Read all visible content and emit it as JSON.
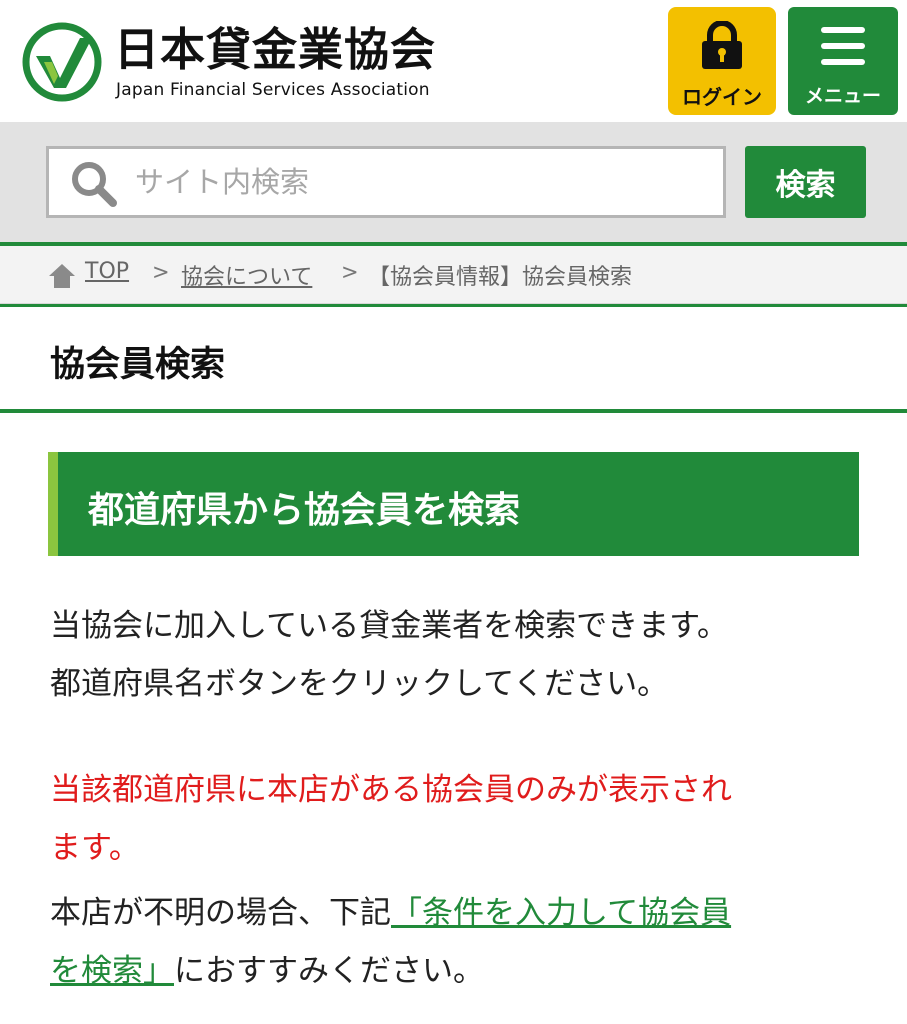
{
  "header": {
    "logo_jp": "日本貸金業協会",
    "logo_en": "Japan Financial Services Association",
    "login_label": "ログイン",
    "menu_label": "メニュー",
    "brand_green": "#218a3a",
    "login_yellow": "#f3c000"
  },
  "search": {
    "placeholder": "サイト内検索",
    "button_label": "検索"
  },
  "breadcrumb": {
    "items": [
      "TOP",
      "協会について",
      "【協会員情報】協会員検索"
    ],
    "separator": ">"
  },
  "page": {
    "title": "協会員検索"
  },
  "section": {
    "heading": "都道府県から協会員を検索"
  },
  "body": {
    "intro_line1": "当協会に加入している貸金業者を検索できます。",
    "intro_line2": "都道府県名ボタンをクリックしてください。",
    "notice_line1": "当該都道府県に本店がある協会員のみが表示され",
    "notice_line2": "ます。",
    "unknown_prefix": "本店が不明の場合、下記",
    "link_line1": "「条件を入力して協会員",
    "link_line2": "を検索」",
    "unknown_suffix": "におすすみください。",
    "notice_color": "#e01c1c"
  }
}
